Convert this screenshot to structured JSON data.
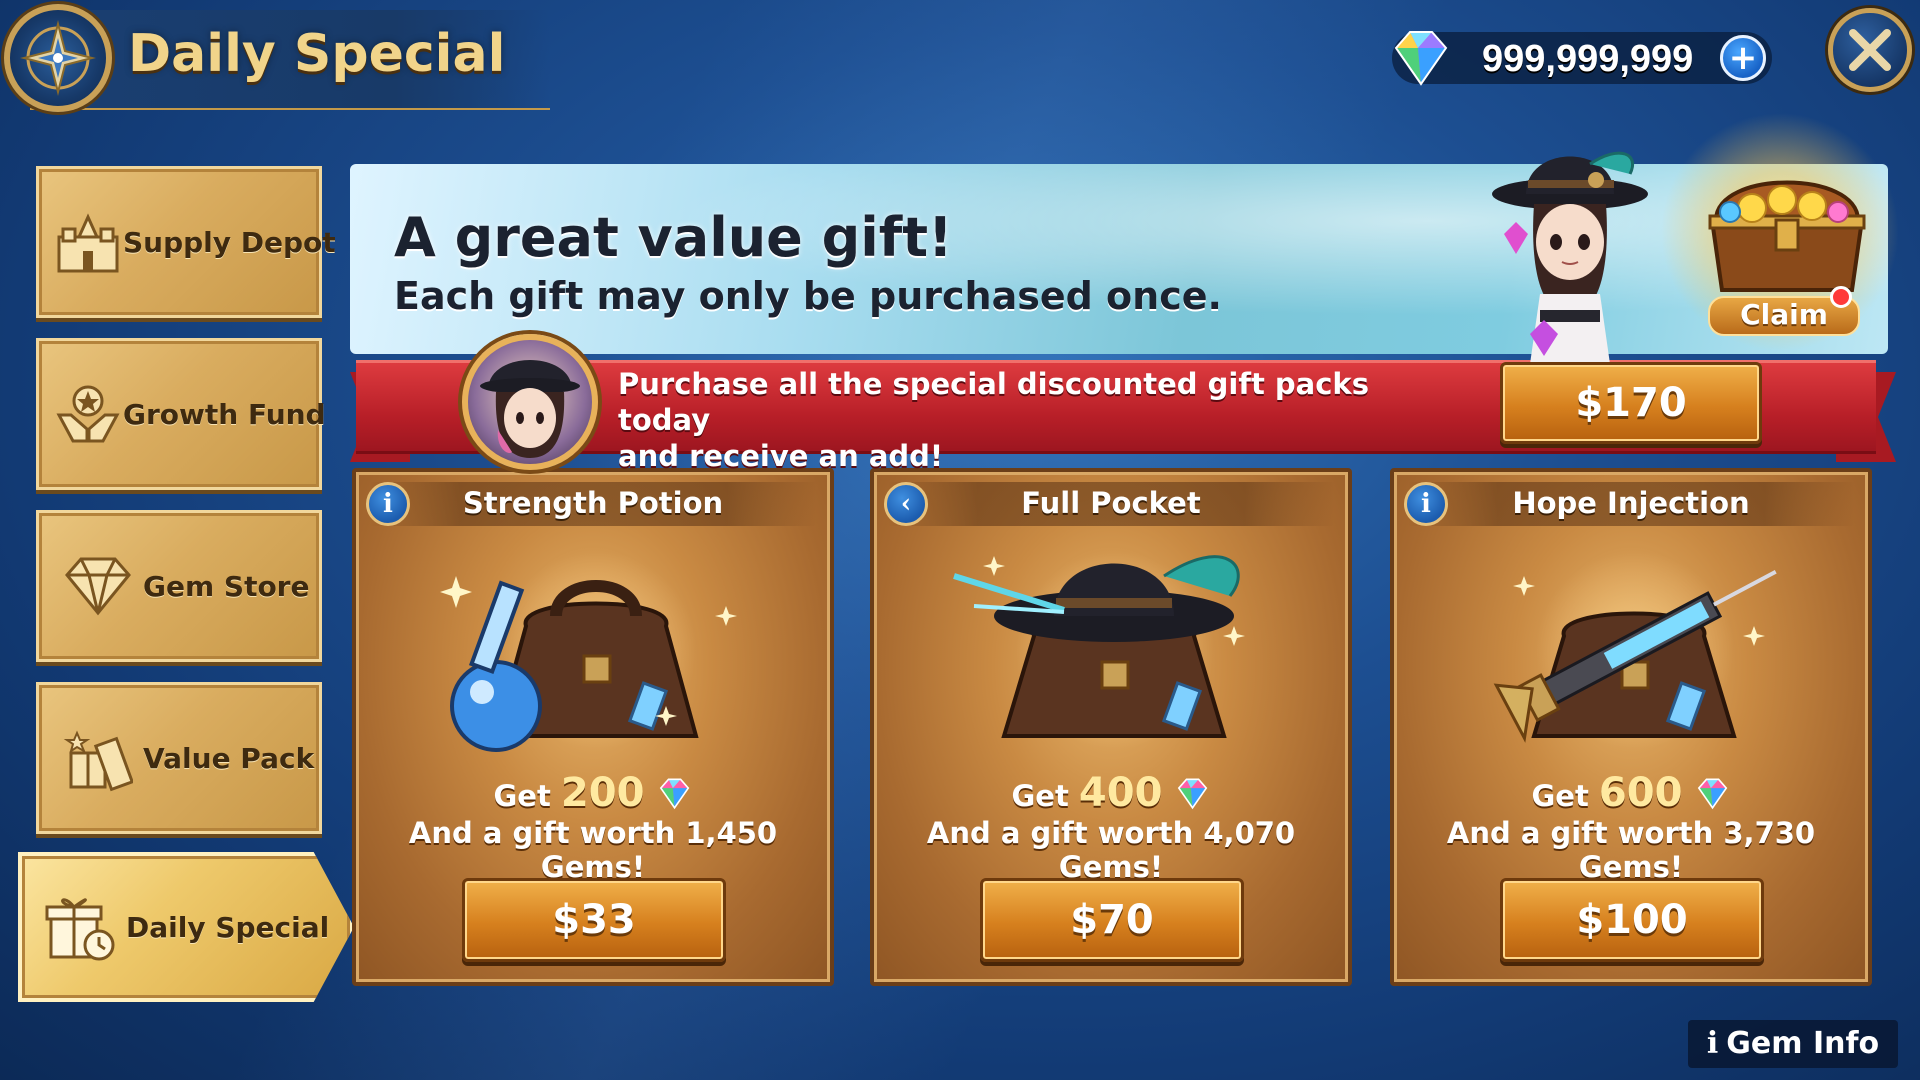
{
  "header": {
    "title": "Daily Special",
    "currency_value": "999,999,999",
    "plus_label": "+"
  },
  "sidebar": {
    "items": [
      {
        "label": "Supply Depot",
        "icon": "castle-icon"
      },
      {
        "label": "Growth Fund",
        "icon": "hands-star-icon"
      },
      {
        "label": "Gem Store",
        "icon": "diamond-icon"
      },
      {
        "label": "Value Pack",
        "icon": "gift-boxes-icon"
      },
      {
        "label": "Daily Special",
        "icon": "gift-clock-icon",
        "active": true
      }
    ]
  },
  "banner": {
    "title": "A great value gift!",
    "subtitle": "Each gift may only be purchased once.",
    "claim_label": "Claim"
  },
  "ribbon": {
    "text_line1": "Purchase all the special discounted gift packs today",
    "text_line2": "and receive an add!",
    "price": "$170"
  },
  "cards": [
    {
      "title": "Strength Potion",
      "corner": "i",
      "corner_icon": "info-icon",
      "get_label": "Get",
      "gems": "200",
      "worth": "And a gift worth 1,450 Gems!",
      "price": "$33",
      "item": "potion-bag"
    },
    {
      "title": "Full Pocket",
      "corner": "‹",
      "corner_icon": "back-arrow-icon",
      "get_label": "Get",
      "gems": "400",
      "worth": "And a gift worth 4,070 Gems!",
      "price": "$70",
      "item": "hat-bag"
    },
    {
      "title": "Hope Injection",
      "corner": "i",
      "corner_icon": "info-icon",
      "get_label": "Get",
      "gems": "600",
      "worth": "And a gift worth 3,730 Gems!",
      "price": "$100",
      "item": "syringe-bag"
    }
  ],
  "footer": {
    "gem_info_icon": "i",
    "gem_info_label": "Gem Info"
  },
  "colors": {
    "gold_text": "#f1d48a",
    "ribbon_red": "#c42630",
    "button_orange": "#d6801e",
    "card_brown": "#c98a43"
  }
}
